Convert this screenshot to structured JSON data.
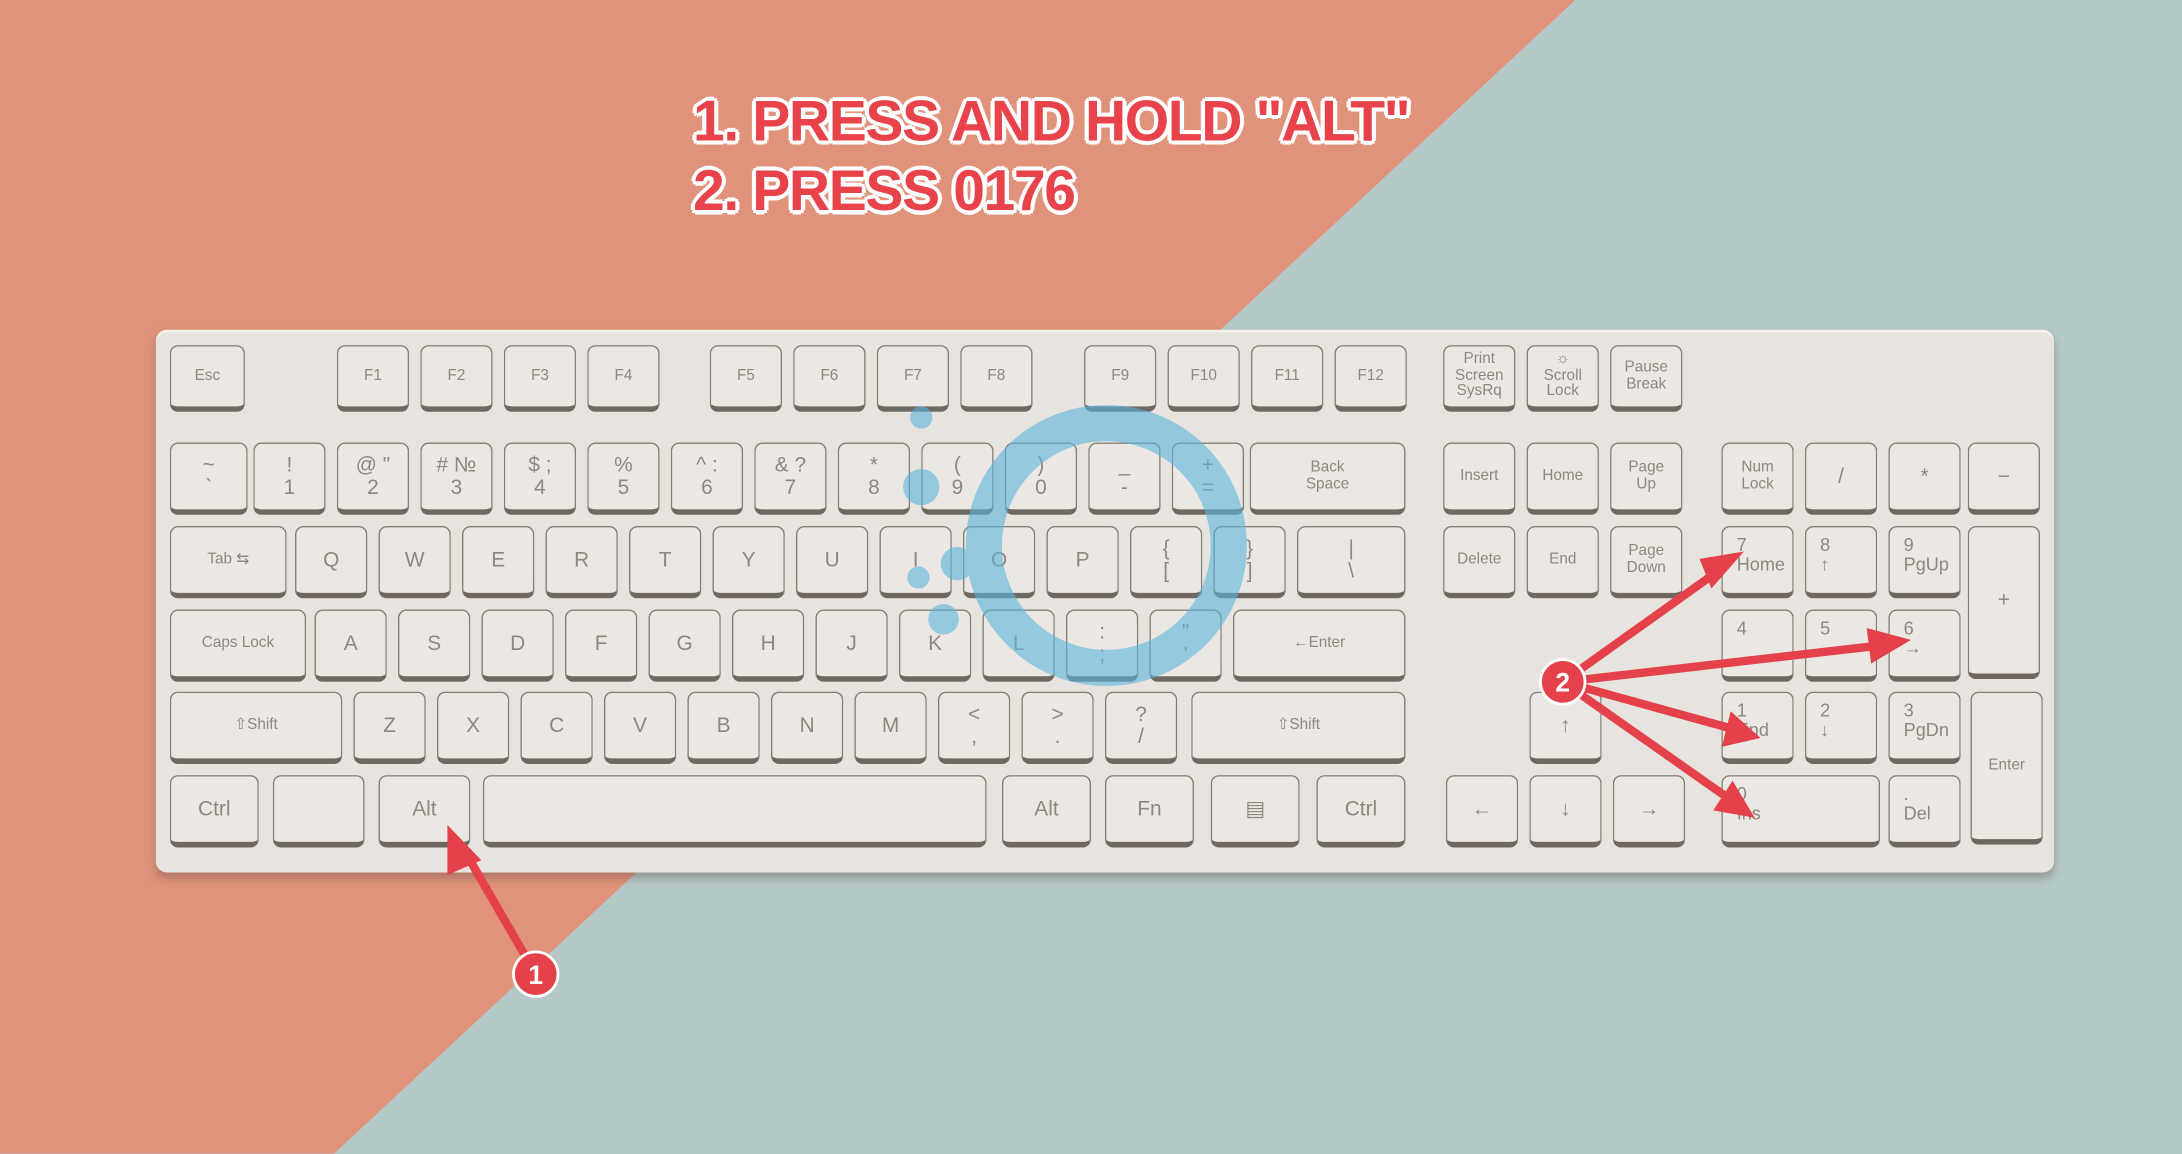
{
  "instructions": {
    "line1": "1. PRESS AND HOLD \"ALT\"",
    "line2": "2. PRESS 0176"
  },
  "annotations": {
    "badge1": "1",
    "badge2": "2",
    "color": "#e5414a"
  },
  "colors": {
    "background_left": "#e0937a",
    "background_right": "#b4c8c7",
    "keyboard": "#e7e3de",
    "watermark": "#5ab4dc"
  },
  "keyboard": {
    "keys": [
      "Esc",
      "F1",
      "F2",
      "F3",
      "F4",
      "F5",
      "F6",
      "F7",
      "F8",
      "F9",
      "F10",
      "F11",
      "F12",
      "Print\nScreen\nSysRq",
      "☼\nScroll\nLock",
      "Pause\nBreak",
      "~\n`",
      "!\n1",
      "@  \"\n2",
      "#  №\n3",
      "$  ;\n4",
      "%\n5",
      "^  :\n6",
      "&  ?\n7",
      "*\n8",
      "(\n9",
      ")\n0",
      "_\n-",
      "+\n=",
      "Back\nSpace",
      "Insert",
      "Home",
      "Page\nUp",
      "Num\nLock",
      "/",
      "*",
      "−",
      "Tab ⇆",
      "Q",
      "W",
      "E",
      "R",
      "T",
      "Y",
      "U",
      "I",
      "O",
      "P",
      "{\n[",
      "}\n]",
      "|\n\\",
      "Delete",
      "End",
      "Page\nDown",
      "7\nHome",
      "8\n↑",
      "9\nPgUp",
      "+",
      "Caps Lock",
      "A",
      "S",
      "D",
      "F",
      "G",
      "H",
      "J",
      "K",
      "L",
      ":\n;",
      "\"\n'",
      "←Enter",
      "4",
      "5",
      "6\n→",
      "⇧Shift",
      "Z",
      "X",
      "C",
      "V",
      "B",
      "N",
      "M",
      "<\n,",
      ">\n.",
      "?\n/",
      "⇧Shift",
      "↑",
      "1\nEnd",
      "2\n↓",
      "3\nPgDn",
      "Enter",
      "Ctrl",
      "",
      "Alt",
      "",
      "Alt",
      "Fn",
      "▤",
      "Ctrl",
      "←",
      "↓",
      "→",
      "0\nIns",
      ".\nDel"
    ]
  }
}
